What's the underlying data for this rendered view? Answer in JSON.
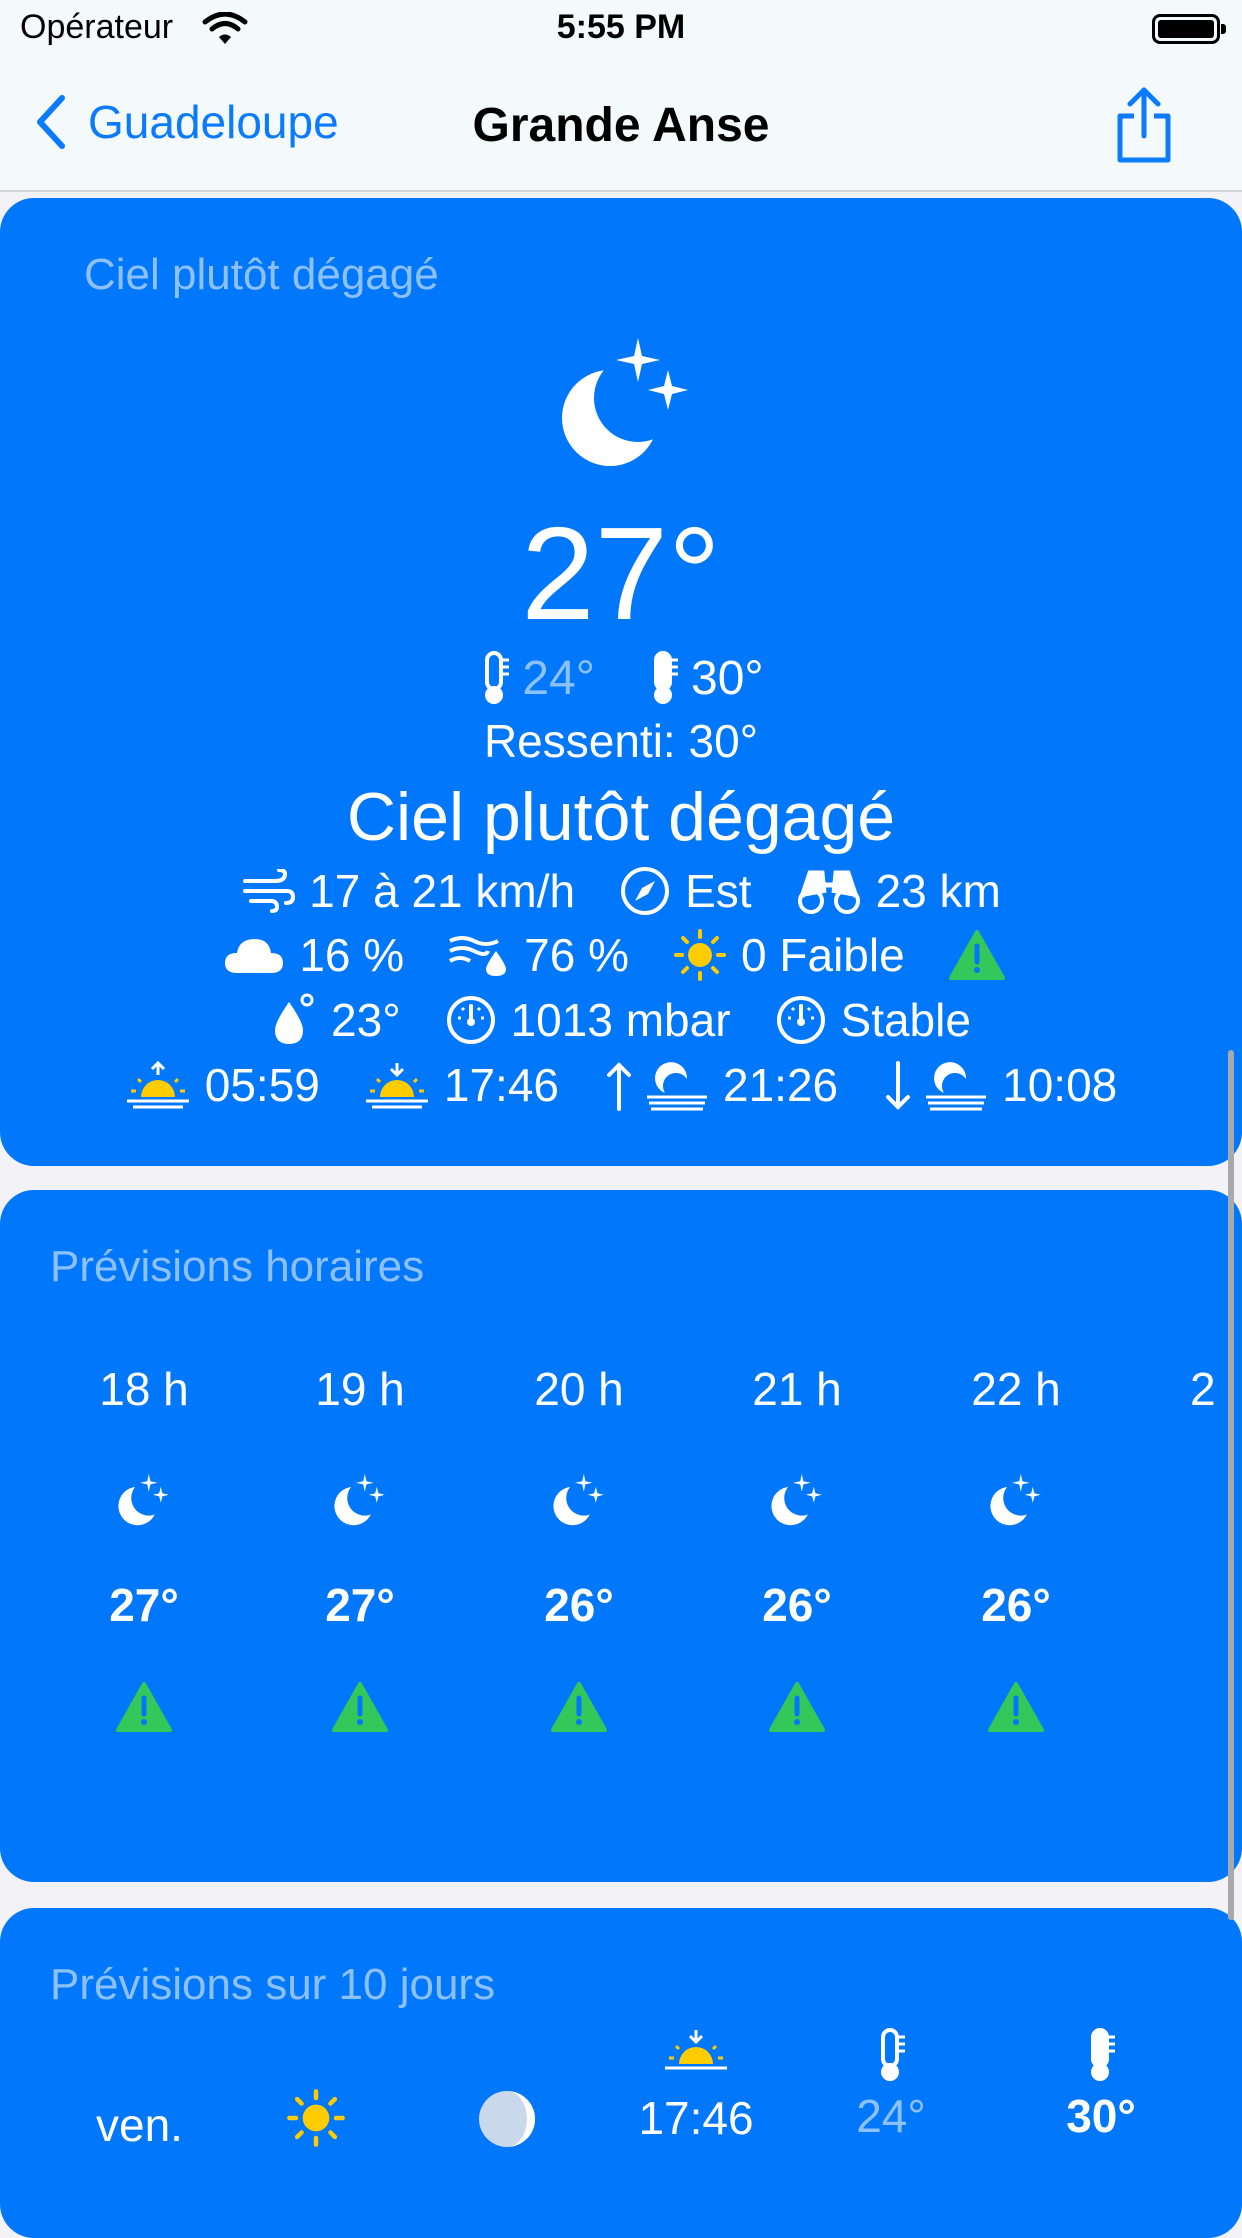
{
  "status": {
    "carrier": "Opérateur",
    "time": "5:55 PM"
  },
  "nav": {
    "back": "Guadeloupe",
    "title": "Grande Anse"
  },
  "current": {
    "heading": "Ciel plutôt dégagé",
    "icon": "moon-stars-icon",
    "temp": "27°",
    "min": "24°",
    "max": "30°",
    "feels": "Ressenti: 30°",
    "description": "Ciel plutôt dégagé",
    "wind": "17 à 21 km/h",
    "direction": "Est",
    "visibility": "23 km",
    "cloud": "16 %",
    "humidity": "76 %",
    "uv": "0 Faible",
    "dewpoint": "23°",
    "pressure": "1013 mbar",
    "trend": "Stable",
    "sunrise": "05:59",
    "sunset": "17:46",
    "moonrise": "21:26",
    "moonset": "10:08"
  },
  "hourly": {
    "heading": "Prévisions horaires",
    "hours": [
      {
        "h": "18 h",
        "t": "27°"
      },
      {
        "h": "19 h",
        "t": "27°"
      },
      {
        "h": "20 h",
        "t": "26°"
      },
      {
        "h": "21 h",
        "t": "26°"
      },
      {
        "h": "22 h",
        "t": "26°"
      },
      {
        "h": "2",
        "t": ""
      }
    ]
  },
  "tenday": {
    "heading": "Prévisions sur 10 jours",
    "day": "ven.",
    "sunset": "17:46",
    "min": "24°",
    "max": "30°"
  },
  "colors": {
    "card": "#0177fb",
    "tint": "#0a7aff",
    "sun": "#ffcc00",
    "warning": "#34c759"
  }
}
